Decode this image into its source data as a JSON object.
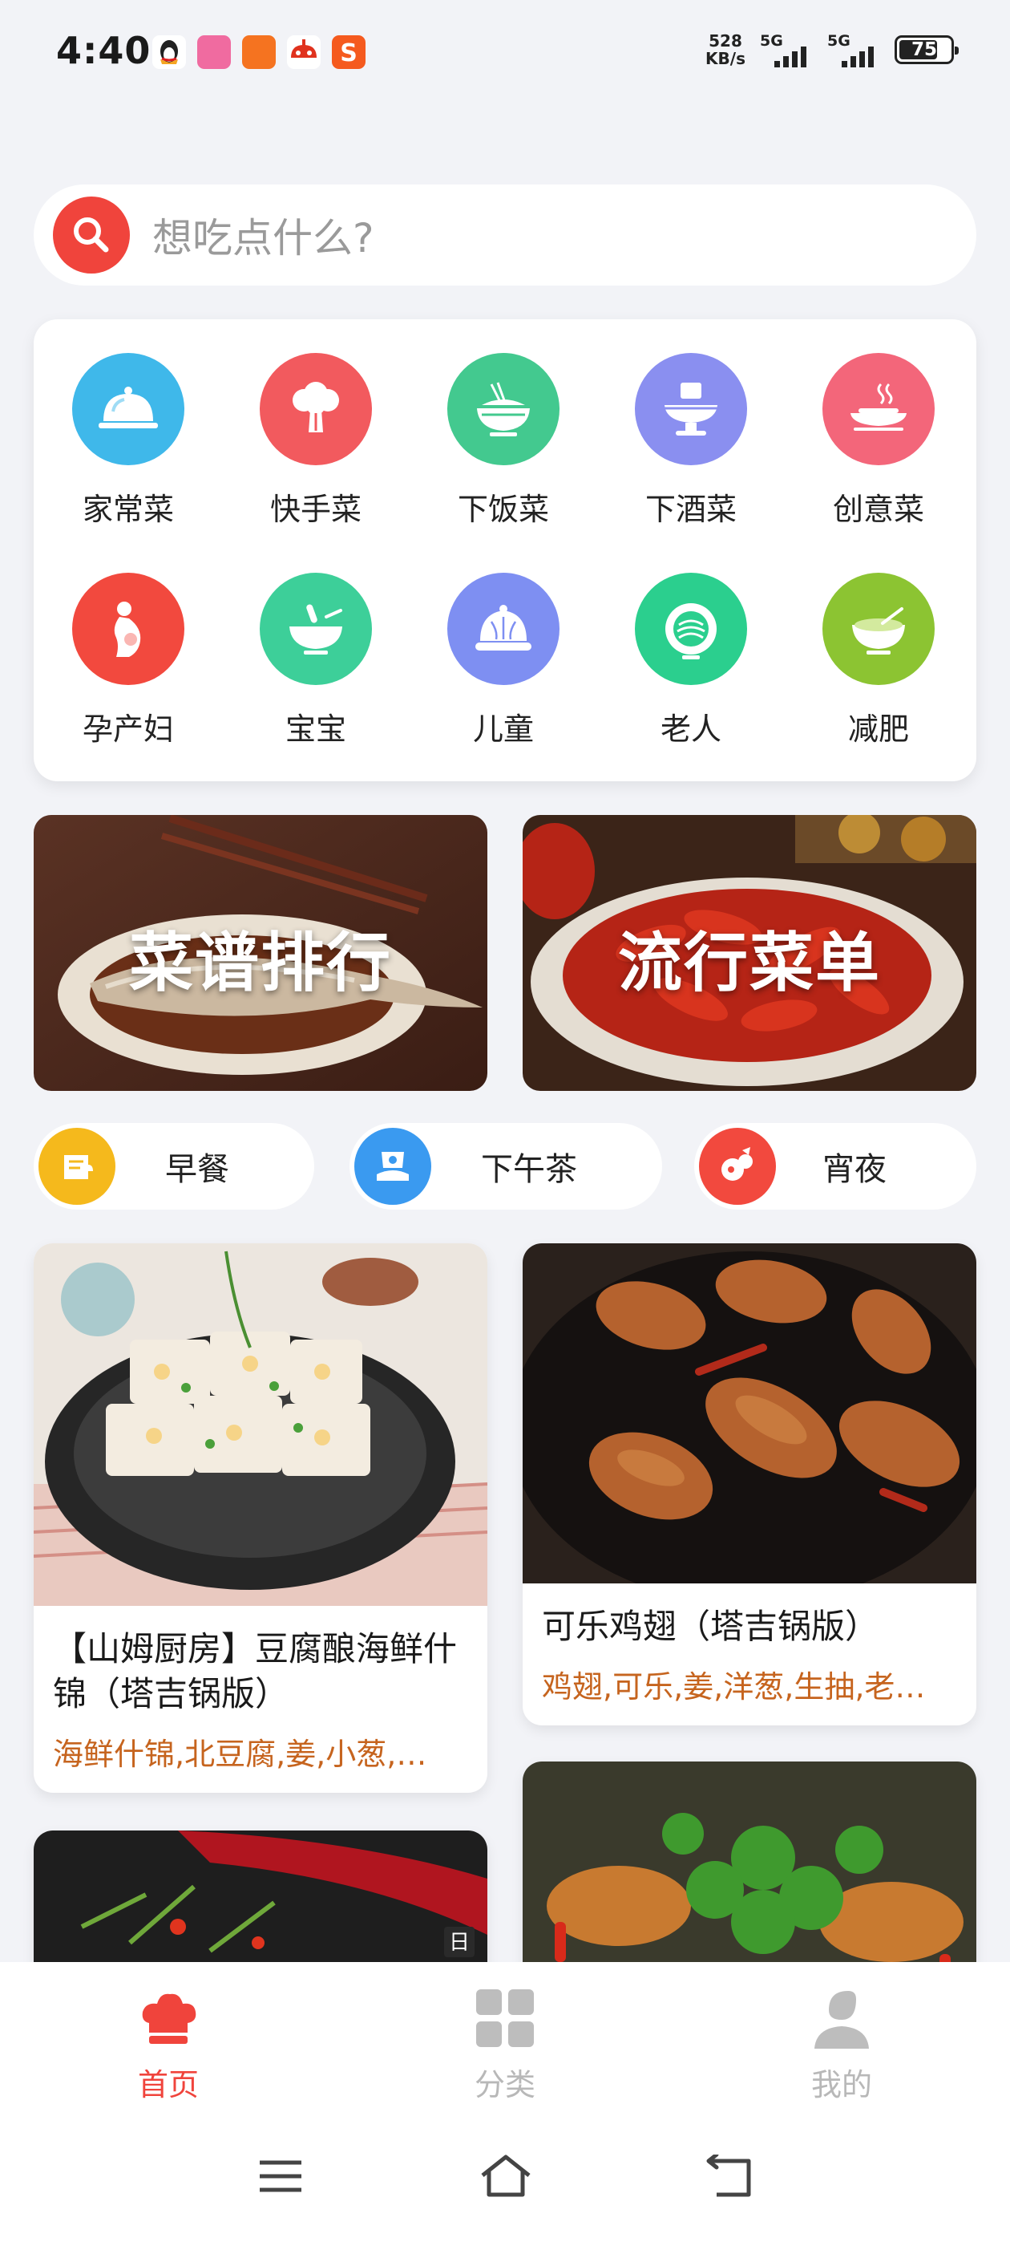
{
  "status_bar": {
    "time": "4:40",
    "speed_value": "528",
    "speed_unit": "KB/s",
    "signal1_label": "5G",
    "signal2_label": "5G",
    "battery": "75"
  },
  "search": {
    "placeholder": "想吃点什么?"
  },
  "categories": [
    {
      "label": "家常菜",
      "icon": "cloche-icon",
      "color": "#3fb8ea"
    },
    {
      "label": "快手菜",
      "icon": "broccoli-icon",
      "color": "#f25a5e"
    },
    {
      "label": "下饭菜",
      "icon": "rice-bowl-icon",
      "color": "#43c98f"
    },
    {
      "label": "下酒菜",
      "icon": "hotpot-icon",
      "color": "#8a8ff0"
    },
    {
      "label": "创意菜",
      "icon": "plate-icon",
      "color": "#f3667a"
    },
    {
      "label": "孕产妇",
      "icon": "pregnant-icon",
      "color": "#f2493e"
    },
    {
      "label": "宝宝",
      "icon": "baby-bowl-icon",
      "color": "#3dcf99"
    },
    {
      "label": "儿童",
      "icon": "bun-icon",
      "color": "#7e8ff2"
    },
    {
      "label": "老人",
      "icon": "noodle-bowl-icon",
      "color": "#2bcf8e"
    },
    {
      "label": "减肥",
      "icon": "salad-bowl-icon",
      "color": "#8cc432"
    }
  ],
  "banners": [
    {
      "text": "菜谱排行"
    },
    {
      "text": "流行菜单"
    }
  ],
  "meals": [
    {
      "label": "早餐",
      "icon": "breakfast-icon",
      "color": "#f5b91c"
    },
    {
      "label": "下午茶",
      "icon": "afternoon-tea-icon",
      "color": "#3a9af0"
    },
    {
      "label": "宵夜",
      "icon": "late-night-icon",
      "color": "#f2493e"
    }
  ],
  "recipes": [
    {
      "title": "【山姆厨房】豆腐酿海鲜什锦（塔吉锅版）",
      "ingredients": "海鲜什锦,北豆腐,姜,小葱,…"
    },
    {
      "title": "可乐鸡翅（塔吉锅版）",
      "ingredients": "鸡翅,可乐,姜,洋葱,生抽,老…"
    }
  ],
  "partial_card_badge": "日",
  "bottom_nav": [
    {
      "label": "首页",
      "active": true
    },
    {
      "label": "分类",
      "active": false
    },
    {
      "label": "我的",
      "active": false
    }
  ],
  "colors": {
    "accent": "#f0443c",
    "ingredient": "#c6641e",
    "inactive": "#b8b8b8"
  }
}
